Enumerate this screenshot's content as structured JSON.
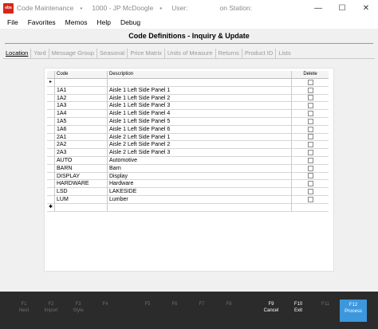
{
  "window": {
    "app_name": "Code Maintenance",
    "separator": "•",
    "account": "1000 - JP McDoogle",
    "user_label": "User:",
    "station_label": "on Station:",
    "logo_text": "ebs",
    "minimize": "—",
    "maximize": "☐",
    "close": "✕"
  },
  "menu": [
    "File",
    "Favorites",
    "Memos",
    "Help",
    "Debug"
  ],
  "form_title": "Code Definitions - Inquiry & Update",
  "tabs": [
    {
      "label": "Location",
      "active": true
    },
    {
      "label": "Yard",
      "active": false
    },
    {
      "label": "Message Group",
      "active": false
    },
    {
      "label": "Seasonal",
      "active": false
    },
    {
      "label": "Price Matrix",
      "active": false
    },
    {
      "label": "Units of Measure",
      "active": false
    },
    {
      "label": "Returns",
      "active": false
    },
    {
      "label": "Product ID",
      "active": false
    },
    {
      "label": "Lists",
      "active": false
    }
  ],
  "grid": {
    "columns": [
      "Code",
      "Description",
      "Delete"
    ],
    "current_row_marker": "▸",
    "new_row_marker": "✱",
    "rows": [
      {
        "code": "1A1",
        "description": "Aisle 1 Left Side Panel 1"
      },
      {
        "code": "1A2",
        "description": "Aisle 1 Left Side Panel 2"
      },
      {
        "code": "1A3",
        "description": "Aisle 1 Left Side Panel 3"
      },
      {
        "code": "1A4",
        "description": "Aisle 1 Left Side Panel 4"
      },
      {
        "code": "1A5",
        "description": "Aisle 1 Left Side Panel 5"
      },
      {
        "code": "1A6",
        "description": "Aisle 1 Left Side Panel 6"
      },
      {
        "code": "2A1",
        "description": "Aisle 2 Left Side Panel 1"
      },
      {
        "code": "2A2",
        "description": "Aisle 2 Left Side Panel 2"
      },
      {
        "code": "2A3",
        "description": "Aisle 2 Left Side Panel 3"
      },
      {
        "code": "AUTO",
        "description": "Automotive"
      },
      {
        "code": "BARN",
        "description": "Barn"
      },
      {
        "code": "DISPLAY",
        "description": "Display"
      },
      {
        "code": "HARDWARE",
        "description": "Hardware"
      },
      {
        "code": "LSD",
        "description": "LAKESIDE"
      },
      {
        "code": "LUM",
        "description": "Lumber"
      }
    ]
  },
  "fkeys": [
    {
      "key": "F1",
      "label": "Next",
      "enabled": false,
      "primary": false
    },
    {
      "key": "F2",
      "label": "Import",
      "enabled": false,
      "primary": false
    },
    {
      "key": "F3",
      "label": "Style",
      "enabled": false,
      "primary": false
    },
    {
      "key": "F4",
      "label": "",
      "enabled": false,
      "primary": false
    },
    {
      "key": "F5",
      "label": "",
      "enabled": false,
      "primary": false
    },
    {
      "key": "F6",
      "label": "",
      "enabled": false,
      "primary": false
    },
    {
      "key": "F7",
      "label": "",
      "enabled": false,
      "primary": false
    },
    {
      "key": "F8",
      "label": "",
      "enabled": false,
      "primary": false
    },
    {
      "key": "F9",
      "label": "Cancel",
      "enabled": true,
      "primary": false
    },
    {
      "key": "F10",
      "label": "Exit",
      "enabled": true,
      "primary": false
    },
    {
      "key": "F11",
      "label": "",
      "enabled": false,
      "primary": false
    },
    {
      "key": "F12",
      "label": "Process",
      "enabled": true,
      "primary": true
    }
  ]
}
